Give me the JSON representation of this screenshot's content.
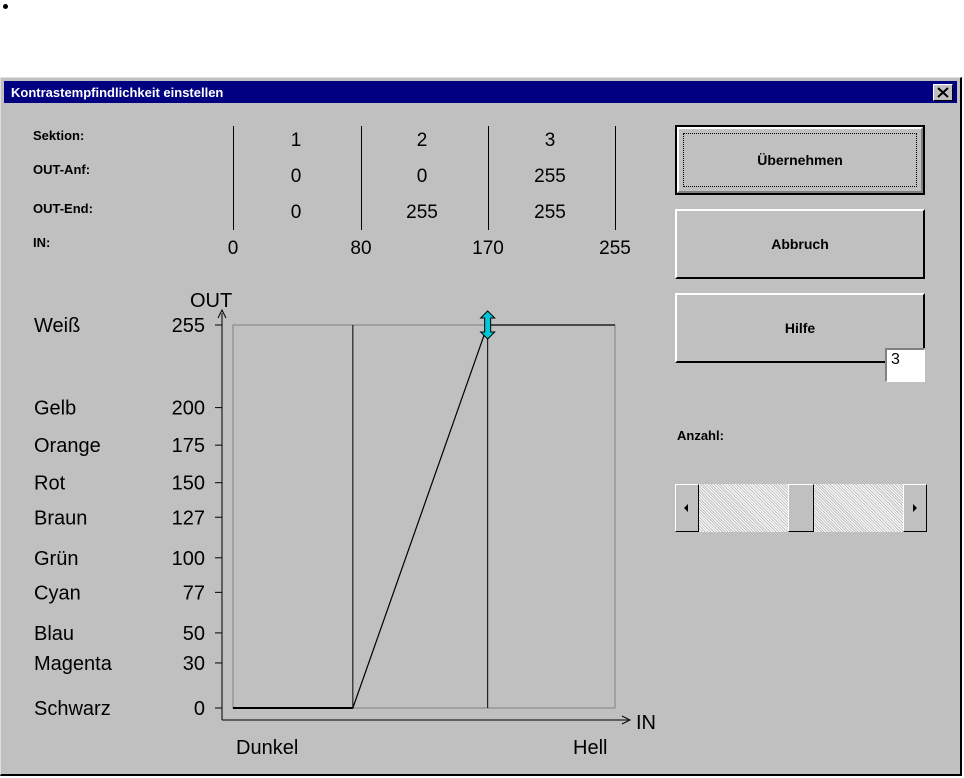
{
  "dialog": {
    "title": "Kontrastempfindlichkeit einstellen",
    "close_icon": "close-icon"
  },
  "table": {
    "row_labels": {
      "section": "Sektion:",
      "out_start": "OUT-Anf:",
      "out_end": "OUT-End:",
      "in": "IN:"
    },
    "sections": [
      {
        "number": "1",
        "out_start": "0",
        "out_end": "0"
      },
      {
        "number": "2",
        "out_start": "0",
        "out_end": "255"
      },
      {
        "number": "3",
        "out_start": "255",
        "out_end": "255"
      }
    ],
    "in_boundaries": [
      "0",
      "80",
      "170",
      "255"
    ]
  },
  "buttons": {
    "apply": "Übernehmen",
    "cancel": "Abbruch",
    "help": "Hilfe"
  },
  "count": {
    "label": "Anzahl:",
    "value": "3",
    "slider_fraction": 0.5
  },
  "chart_data": {
    "type": "line",
    "ylabel": "OUT",
    "xlabel": "IN",
    "x_start_label": "Dunkel",
    "x_end_label": "Hell",
    "xlim": [
      0,
      255
    ],
    "ylim": [
      0,
      255
    ],
    "y_ticks": [
      {
        "value": 255,
        "label": "255",
        "color": "Weiß"
      },
      {
        "value": 200,
        "label": "200",
        "color": "Gelb"
      },
      {
        "value": 175,
        "label": "175",
        "color": "Orange"
      },
      {
        "value": 150,
        "label": "150",
        "color": "Rot"
      },
      {
        "value": 127,
        "label": "127",
        "color": "Braun"
      },
      {
        "value": 100,
        "label": "100",
        "color": "Grün"
      },
      {
        "value": 77,
        "label": "77",
        "color": "Cyan"
      },
      {
        "value": 50,
        "label": "50",
        "color": "Blau"
      },
      {
        "value": 30,
        "label": "30",
        "color": "Magenta"
      },
      {
        "value": 0,
        "label": "0",
        "color": "Schwarz"
      }
    ],
    "section_boundaries": [
      80,
      170
    ],
    "points": [
      [
        0,
        0
      ],
      [
        80,
        0
      ],
      [
        170,
        255
      ],
      [
        255,
        255
      ]
    ],
    "handle": {
      "x": 170,
      "y": 255,
      "color": "#00c8d8",
      "icon": "vertical-resize-handle-icon"
    }
  }
}
